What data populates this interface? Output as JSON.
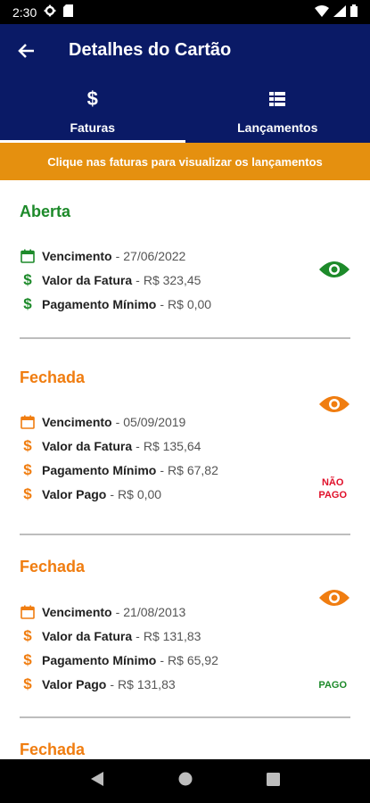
{
  "status_bar": {
    "time": "2:30"
  },
  "header": {
    "title": "Detalhes do Cartão"
  },
  "tabs": [
    {
      "label": "Faturas",
      "icon": "dollar-icon",
      "selected": true
    },
    {
      "label": "Lançamentos",
      "icon": "list-icon",
      "selected": false
    }
  ],
  "banner": {
    "text": "Clique nas faturas para visualizar os lançamentos"
  },
  "invoices": [
    {
      "status": "Aberta",
      "vencimento_label": "Vencimento",
      "vencimento": "27/06/2022",
      "valor_label": "Valor da Fatura",
      "valor": "R$ 323,45",
      "minimo_label": "Pagamento Mínimo",
      "minimo": "R$ 0,00"
    },
    {
      "status": "Fechada",
      "vencimento_label": "Vencimento",
      "vencimento": "05/09/2019",
      "valor_label": "Valor da Fatura",
      "valor": "R$ 135,64",
      "minimo_label": "Pagamento Mínimo",
      "minimo": "R$ 67,82",
      "pago_label": "Valor Pago",
      "pago": "R$ 0,00",
      "payment_status_line1": "NÃO",
      "payment_status_line2": "PAGO"
    },
    {
      "status": "Fechada",
      "vencimento_label": "Vencimento",
      "vencimento": "21/08/2013",
      "valor_label": "Valor da Fatura",
      "valor": "R$ 131,83",
      "minimo_label": "Pagamento Mínimo",
      "minimo": "R$ 65,92",
      "pago_label": "Valor Pago",
      "pago": "R$ 131,83",
      "payment_status": "PAGO"
    },
    {
      "status": "Fechada"
    }
  ],
  "separator": "-",
  "colors": {
    "header": "#0a1a66",
    "banner": "#e5900f",
    "open": "#1d8a2a",
    "closed": "#f07d10",
    "unpaid": "#e0102a",
    "paid": "#1d8a2a"
  }
}
